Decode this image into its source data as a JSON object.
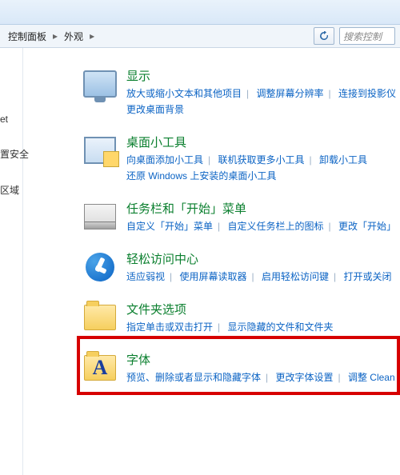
{
  "breadcrumb": {
    "items": [
      "控制面板",
      "外观"
    ],
    "chev": "▸"
  },
  "search": {
    "placeholder": "搜索控制"
  },
  "sidebar": {
    "items": [
      "et",
      "",
      "置安全",
      "",
      "区域"
    ]
  },
  "cats": {
    "display": {
      "title": "显示",
      "links": [
        "放大或缩小文本和其他项目",
        "调整屏幕分辨率",
        "连接到投影仪",
        "更改桌面背景"
      ]
    },
    "gadgets": {
      "title": "桌面小工具",
      "links": [
        "向桌面添加小工具",
        "联机获取更多小工具",
        "卸载小工具",
        "还原 Windows 上安装的桌面小工具"
      ]
    },
    "taskbar": {
      "title": "任务栏和「开始」菜单",
      "links": [
        "自定义「开始」菜单",
        "自定义任务栏上的图标",
        "更改「开始」"
      ]
    },
    "ease": {
      "title": "轻松访问中心",
      "links": [
        "适应弱视",
        "使用屏幕读取器",
        "启用轻松访问键",
        "打开或关闭"
      ]
    },
    "folder": {
      "title": "文件夹选项",
      "links": [
        "指定单击或双击打开",
        "显示隐藏的文件和文件夹"
      ]
    },
    "fonts": {
      "title": "字体",
      "links": [
        "预览、删除或者显示和隐藏字体",
        "更改字体设置",
        "调整 Clean"
      ]
    }
  }
}
